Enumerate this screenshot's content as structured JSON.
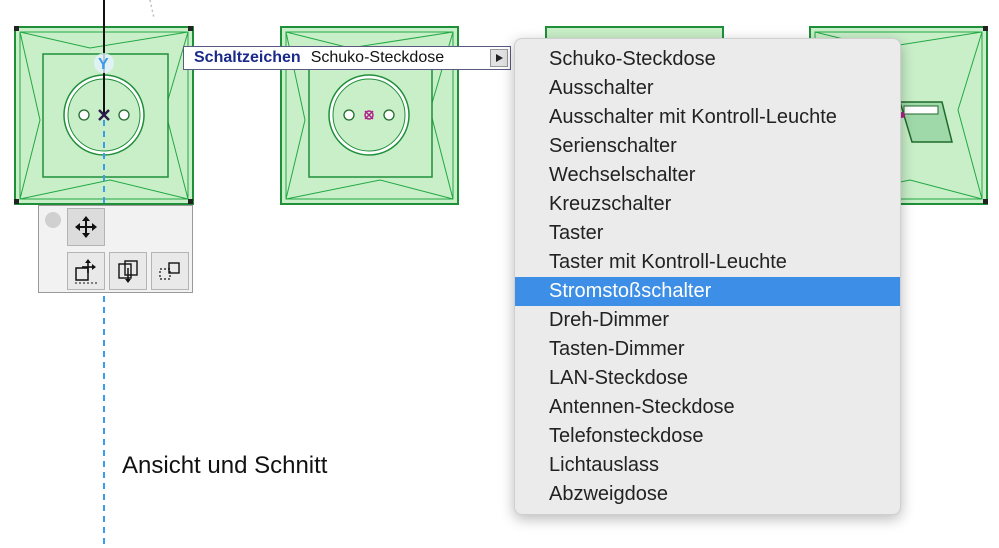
{
  "parameter_bar": {
    "name": "Schaltzeichen",
    "value": "Schuko-Steckdose"
  },
  "dropdown": {
    "selected_index": 8,
    "items": [
      "Schuko-Steckdose",
      "Ausschalter",
      "Ausschalter mit Kontroll-Leuchte",
      "Serienschalter",
      "Wechselschalter",
      "Kreuzschalter",
      "Taster",
      "Taster mit Kontroll-Leuchte",
      "Stromstoßschalter",
      "Dreh-Dimmer",
      "Tasten-Dimmer",
      "LAN-Steckdose",
      "Antennen-Steckdose",
      "Telefonsteckdose",
      "Lichtauslass",
      "Abzweigdose"
    ]
  },
  "view_label": "Ansicht und Schnitt",
  "colors": {
    "plate_fill": "#c9efc9",
    "plate_stroke": "#22a844",
    "selection_blue": "#3d8ee6",
    "guide_line": "#3d9be9"
  },
  "palette": {
    "tools": [
      "move-icon",
      "multiply-icon",
      "drag-copy-icon",
      "offset-icon"
    ]
  }
}
